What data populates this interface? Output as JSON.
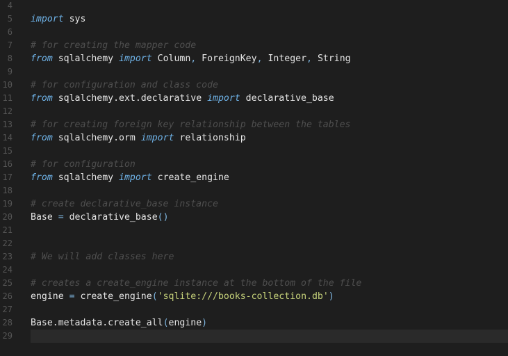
{
  "editor": {
    "lines": [
      {
        "num": "4",
        "tokens": []
      },
      {
        "num": "5",
        "tokens": [
          {
            "t": "kw",
            "v": "import"
          },
          {
            "t": "tx",
            "v": " sys"
          }
        ]
      },
      {
        "num": "6",
        "tokens": []
      },
      {
        "num": "7",
        "tokens": [
          {
            "t": "cm",
            "v": "# for creating the mapper code"
          }
        ]
      },
      {
        "num": "8",
        "tokens": [
          {
            "t": "kw",
            "v": "from"
          },
          {
            "t": "tx",
            "v": " sqlalchemy "
          },
          {
            "t": "kw",
            "v": "import"
          },
          {
            "t": "tx",
            "v": " Column"
          },
          {
            "t": "pn",
            "v": ","
          },
          {
            "t": "tx",
            "v": " ForeignKey"
          },
          {
            "t": "pn",
            "v": ","
          },
          {
            "t": "tx",
            "v": " Integer"
          },
          {
            "t": "pn",
            "v": ","
          },
          {
            "t": "tx",
            "v": " String"
          }
        ]
      },
      {
        "num": "9",
        "tokens": []
      },
      {
        "num": "10",
        "tokens": [
          {
            "t": "cm",
            "v": "# for configuration and class code"
          }
        ]
      },
      {
        "num": "11",
        "tokens": [
          {
            "t": "kw",
            "v": "from"
          },
          {
            "t": "tx",
            "v": " sqlalchemy.ext.declarative "
          },
          {
            "t": "kw",
            "v": "import"
          },
          {
            "t": "tx",
            "v": " declarative_base"
          }
        ]
      },
      {
        "num": "12",
        "tokens": []
      },
      {
        "num": "13",
        "tokens": [
          {
            "t": "cm",
            "v": "# for creating foreign key relationship between the tables"
          }
        ]
      },
      {
        "num": "14",
        "tokens": [
          {
            "t": "kw",
            "v": "from"
          },
          {
            "t": "tx",
            "v": " sqlalchemy.orm "
          },
          {
            "t": "kw",
            "v": "import"
          },
          {
            "t": "tx",
            "v": " relationship"
          }
        ]
      },
      {
        "num": "15",
        "tokens": []
      },
      {
        "num": "16",
        "tokens": [
          {
            "t": "cm",
            "v": "# for configuration"
          }
        ]
      },
      {
        "num": "17",
        "tokens": [
          {
            "t": "kw",
            "v": "from"
          },
          {
            "t": "tx",
            "v": " sqlalchemy "
          },
          {
            "t": "kw",
            "v": "import"
          },
          {
            "t": "tx",
            "v": " create_engine"
          }
        ]
      },
      {
        "num": "18",
        "tokens": []
      },
      {
        "num": "19",
        "tokens": [
          {
            "t": "cm",
            "v": "# create declarative_base instance"
          }
        ]
      },
      {
        "num": "20",
        "tokens": [
          {
            "t": "tx",
            "v": "Base "
          },
          {
            "t": "pn",
            "v": "="
          },
          {
            "t": "tx",
            "v": " declarative_base"
          },
          {
            "t": "pn",
            "v": "()"
          }
        ]
      },
      {
        "num": "21",
        "tokens": []
      },
      {
        "num": "22",
        "tokens": []
      },
      {
        "num": "23",
        "tokens": [
          {
            "t": "cm",
            "v": "# We will add classes here"
          }
        ]
      },
      {
        "num": "24",
        "tokens": []
      },
      {
        "num": "25",
        "tokens": [
          {
            "t": "cm",
            "v": "# creates a create_engine instance at the bottom of the file"
          }
        ]
      },
      {
        "num": "26",
        "tokens": [
          {
            "t": "tx",
            "v": "engine "
          },
          {
            "t": "pn",
            "v": "="
          },
          {
            "t": "tx",
            "v": " create_engine"
          },
          {
            "t": "pn",
            "v": "("
          },
          {
            "t": "st",
            "v": "'sqlite:///books-collection.db'"
          },
          {
            "t": "pn",
            "v": ")"
          }
        ]
      },
      {
        "num": "27",
        "tokens": []
      },
      {
        "num": "28",
        "tokens": [
          {
            "t": "tx",
            "v": "Base.metadata.create_all"
          },
          {
            "t": "pn",
            "v": "("
          },
          {
            "t": "tx",
            "v": "engine"
          },
          {
            "t": "pn",
            "v": ")"
          }
        ]
      },
      {
        "num": "29",
        "tokens": [],
        "current": true
      }
    ]
  },
  "colors": {
    "background": "#1e1e1e",
    "keyword": "#6fb3e8",
    "comment": "#4f4f4f",
    "string": "#c6d27a",
    "text": "#e6e6e6",
    "line_number": "#555555",
    "current_line": "#2a2a2a"
  }
}
